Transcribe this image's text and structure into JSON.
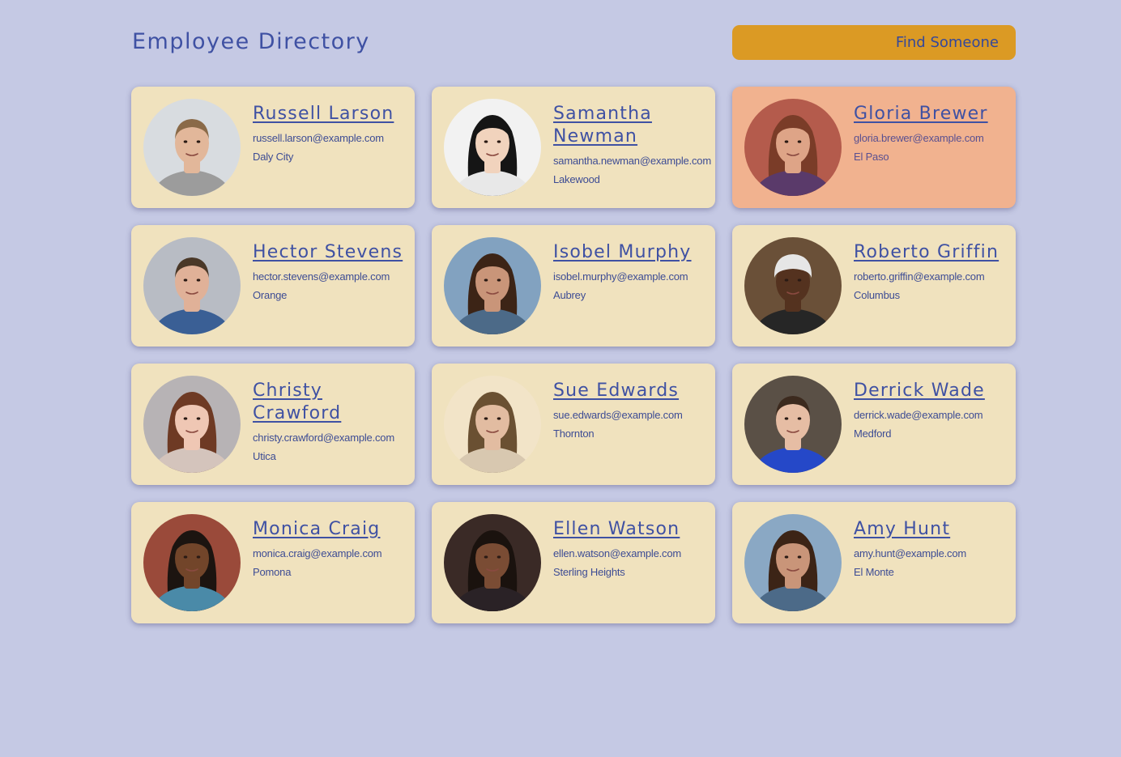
{
  "header": {
    "title": "Employee Directory",
    "search_placeholder": "Find Someone"
  },
  "employees": [
    {
      "name": "Russell Larson",
      "email": "russell.larson@example.com",
      "city": "Daly City",
      "highlighted": false,
      "skin": "#e2b79a",
      "hair": "#8a6a48",
      "shirt": "#9c9c9c",
      "bg": "#d8dce0"
    },
    {
      "name": "Samantha Newman",
      "email": "samantha.newman@example.com",
      "city": "Lakewood",
      "highlighted": false,
      "skin": "#f1d3bd",
      "hair": "#151515",
      "shirt": "#e8e8e8",
      "bg": "#f2f2f2"
    },
    {
      "name": "Gloria Brewer",
      "email": "gloria.brewer@example.com",
      "city": "El Paso",
      "highlighted": true,
      "skin": "#dea487",
      "hair": "#7a3c28",
      "shirt": "#5a3a6a",
      "bg": "#b45b4c"
    },
    {
      "name": "Hector Stevens",
      "email": "hector.stevens@example.com",
      "city": "Orange",
      "highlighted": false,
      "skin": "#e0b198",
      "hair": "#4a3828",
      "shirt": "#3a5f95",
      "bg": "#b8bcc4"
    },
    {
      "name": "Isobel Murphy",
      "email": "isobel.murphy@example.com",
      "city": "Aubrey",
      "highlighted": false,
      "skin": "#c99579",
      "hair": "#3c2416",
      "shirt": "#4c6a88",
      "bg": "#82a2c0"
    },
    {
      "name": "Roberto Griffin",
      "email": "roberto.griffin@example.com",
      "city": "Columbus",
      "highlighted": false,
      "skin": "#54321f",
      "hair": "#e6e6e6",
      "shirt": "#262626",
      "bg": "#6a5038"
    },
    {
      "name": "Christy Crawford",
      "email": "christy.crawford@example.com",
      "city": "Utica",
      "highlighted": false,
      "skin": "#efc7b4",
      "hair": "#6e3a24",
      "shirt": "#d4c4bc",
      "bg": "#b7b3b5"
    },
    {
      "name": "Sue Edwards",
      "email": "sue.edwards@example.com",
      "city": "Thornton",
      "highlighted": false,
      "skin": "#e2bca1",
      "hair": "#6a5032",
      "shirt": "#d8c8b0",
      "bg": "#f2e4c8"
    },
    {
      "name": "Derrick Wade",
      "email": "derrick.wade@example.com",
      "city": "Medford",
      "highlighted": false,
      "skin": "#e6bda4",
      "hair": "#3c2a1e",
      "shirt": "#2548c8",
      "bg": "#5a5046"
    },
    {
      "name": "Monica Craig",
      "email": "monica.craig@example.com",
      "city": "Pomona",
      "highlighted": false,
      "skin": "#72452a",
      "hair": "#1c1410",
      "shirt": "#4a8aa8",
      "bg": "#9a4a3a"
    },
    {
      "name": "Ellen Watson",
      "email": "ellen.watson@example.com",
      "city": "Sterling Heights",
      "highlighted": false,
      "skin": "#7a4c34",
      "hair": "#1a120e",
      "shirt": "#2a2226",
      "bg": "#3a2a26"
    },
    {
      "name": "Amy Hunt",
      "email": "amy.hunt@example.com",
      "city": "El Monte",
      "highlighted": false,
      "skin": "#c99579",
      "hair": "#3c2416",
      "shirt": "#4c6a88",
      "bg": "#8aa8c4"
    }
  ]
}
